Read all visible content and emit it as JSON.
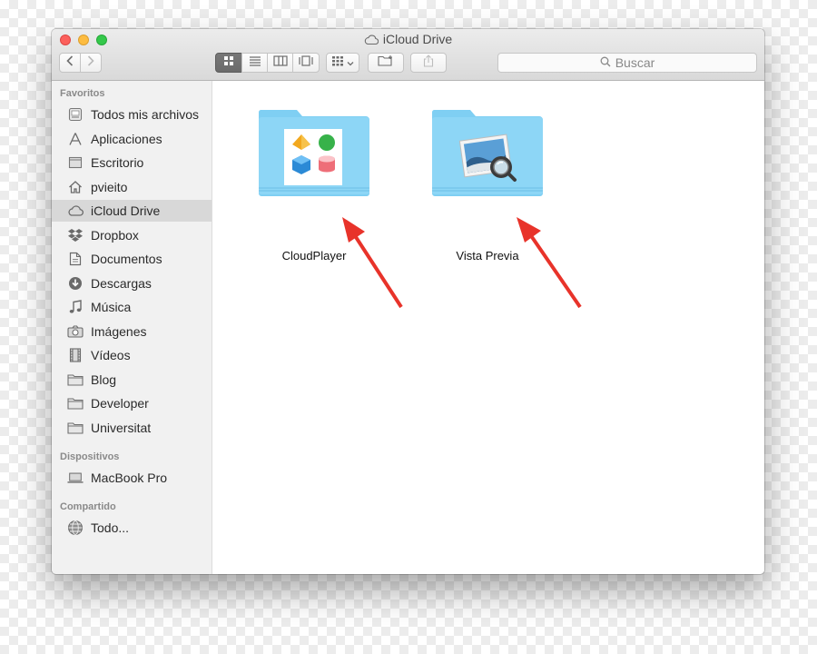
{
  "window": {
    "title": "iCloud Drive",
    "cloud_icon": "cloud-icon"
  },
  "toolbar": {
    "back_icon": "chevron-left-icon",
    "forward_icon": "chevron-right-icon",
    "view_modes": [
      "icon-view-icon",
      "list-view-icon",
      "column-view-icon",
      "cover-flow-icon"
    ],
    "arrange_icon": "arrange-grid-icon",
    "new_folder_icon": "new-folder-icon",
    "share_icon": "share-icon",
    "search_placeholder": "Buscar"
  },
  "sidebar": {
    "favorites_title": "Favoritos",
    "favorites": [
      {
        "label": "Todos mis archivos",
        "icon": "all-files-icon"
      },
      {
        "label": "Aplicaciones",
        "icon": "applications-icon"
      },
      {
        "label": "Escritorio",
        "icon": "desktop-icon"
      },
      {
        "label": "pvieito",
        "icon": "home-icon"
      },
      {
        "label": "iCloud Drive",
        "icon": "cloud-icon",
        "selected": true
      },
      {
        "label": "Dropbox",
        "icon": "dropbox-icon"
      },
      {
        "label": "Documentos",
        "icon": "documents-icon"
      },
      {
        "label": "Descargas",
        "icon": "downloads-icon"
      },
      {
        "label": "Música",
        "icon": "music-icon"
      },
      {
        "label": "Imágenes",
        "icon": "camera-icon"
      },
      {
        "label": "Vídeos",
        "icon": "film-icon"
      },
      {
        "label": "Blog",
        "icon": "folder-icon"
      },
      {
        "label": "Developer",
        "icon": "folder-icon"
      },
      {
        "label": "Universitat",
        "icon": "folder-icon"
      }
    ],
    "devices_title": "Dispositivos",
    "devices": [
      {
        "label": "MacBook Pro",
        "icon": "laptop-icon"
      }
    ],
    "shared_title": "Compartido",
    "shared": [
      {
        "label": "Todo...",
        "icon": "network-icon"
      }
    ]
  },
  "files": [
    {
      "label": "CloudPlayer",
      "icon": "cloudplayer-folder-icon"
    },
    {
      "label": "Vista Previa",
      "icon": "preview-folder-icon"
    }
  ],
  "colors": {
    "folder": "#7fcff3",
    "arrow": "#e8332a",
    "selected_row": "#d8d8d8"
  }
}
